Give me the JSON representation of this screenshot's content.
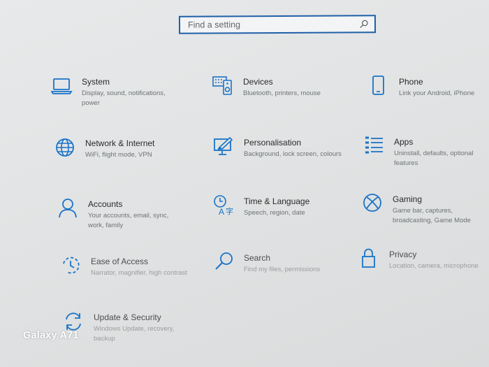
{
  "search": {
    "placeholder": "Find a setting",
    "icon": "search-icon"
  },
  "tiles": [
    {
      "id": "system",
      "title": "System",
      "desc": "Display, sound, notifications, power",
      "icon": "laptop-icon"
    },
    {
      "id": "devices",
      "title": "Devices",
      "desc": "Bluetooth, printers, mouse",
      "icon": "keyboard-speaker-icon"
    },
    {
      "id": "phone",
      "title": "Phone",
      "desc": "Link your Android, iPhone",
      "icon": "phone-icon"
    },
    {
      "id": "network",
      "title": "Network & Internet",
      "desc": "WiFi, flight mode, VPN",
      "icon": "globe-icon"
    },
    {
      "id": "personalisation",
      "title": "Personalisation",
      "desc": "Background, lock screen, colours",
      "icon": "paint-brush-icon"
    },
    {
      "id": "apps",
      "title": "Apps",
      "desc": "Uninstall, defaults, optional features",
      "icon": "apps-list-icon"
    },
    {
      "id": "accounts",
      "title": "Accounts",
      "desc": "Your accounts, email, sync, work, family",
      "icon": "person-icon"
    },
    {
      "id": "time",
      "title": "Time & Language",
      "desc": "Speech, region, date",
      "icon": "time-language-icon"
    },
    {
      "id": "gaming",
      "title": "Gaming",
      "desc": "Game bar, captures, broadcasting, Game Mode",
      "icon": "xbox-icon"
    },
    {
      "id": "ease",
      "title": "Ease of Access",
      "desc": "Narrator, magnifier, high contrast",
      "icon": "ease-of-access-icon"
    },
    {
      "id": "search",
      "title": "Search",
      "desc": "Find my files, permissions",
      "icon": "magnifier-icon"
    },
    {
      "id": "privacy",
      "title": "Privacy",
      "desc": "Location, camera, microphone",
      "icon": "lock-icon"
    },
    {
      "id": "update",
      "title": "Update & Security",
      "desc": "Windows Update, recovery, backup",
      "icon": "sync-arrows-icon"
    }
  ],
  "watermark": "Galaxy A71",
  "colors": {
    "accent": "#1a73c8",
    "search_border": "#1f5fa8"
  }
}
